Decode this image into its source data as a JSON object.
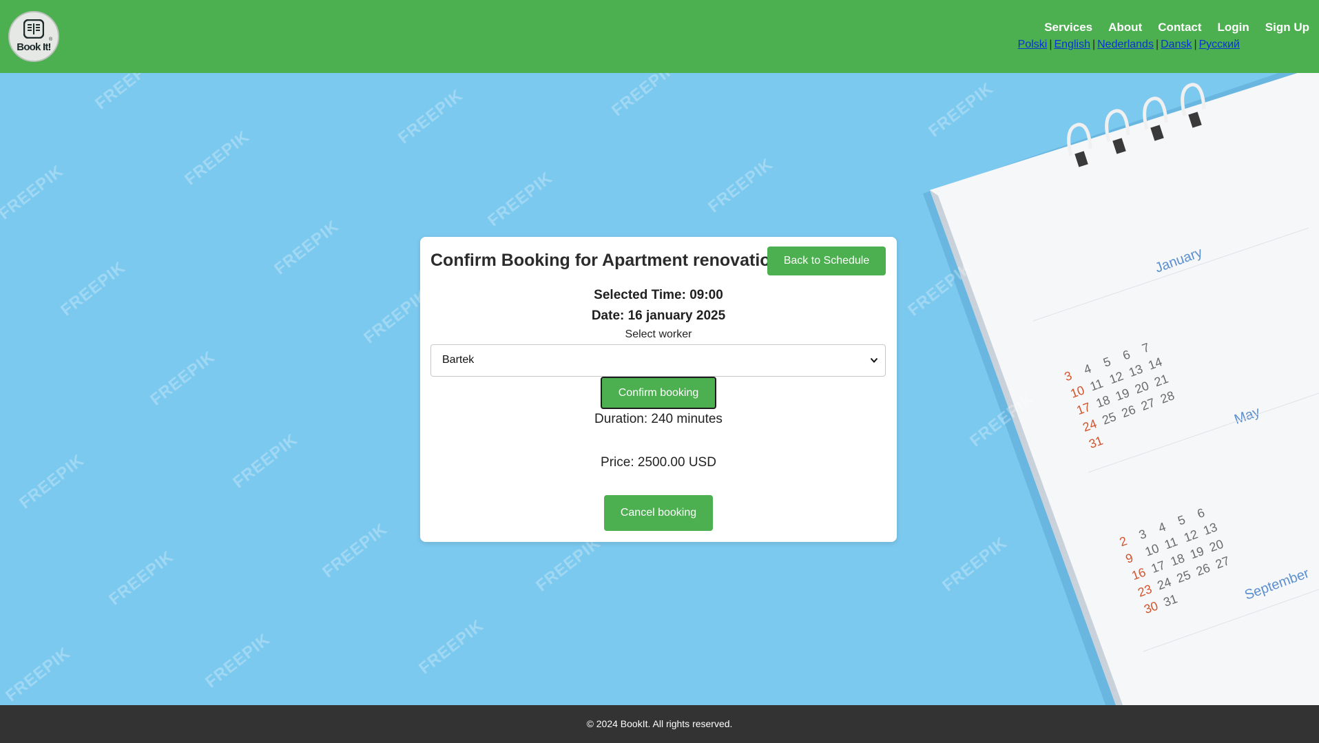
{
  "brand": {
    "logo_text": "Book It!",
    "logo_mark": "®"
  },
  "nav": {
    "items": [
      "Services",
      "About",
      "Contact",
      "Login",
      "Sign Up"
    ]
  },
  "languages": [
    "Polski",
    "English",
    "Nederlands",
    "Dansk",
    "Русский"
  ],
  "language_separator": "|",
  "background": {
    "watermark_text": "FREEPIK",
    "calendar_months": [
      "January",
      "May",
      "September"
    ]
  },
  "booking": {
    "title": "Confirm Booking for Apartment renovation",
    "back_label": "Back to Schedule",
    "selected_time": "Selected Time: 09:00",
    "date": "Date: 16 january 2025",
    "worker_label": "Select worker",
    "worker_value": "Bartek",
    "confirm_label": "Confirm booking",
    "duration": "Duration: 240 minutes",
    "price": "Price: 2500.00 USD",
    "cancel_label": "Cancel booking"
  },
  "footer": {
    "copyright": "© 2024 BookIt. All rights reserved."
  },
  "colors": {
    "header_green": "#4caf50",
    "button_green": "#4caf50",
    "link_blue": "#0a32d6",
    "footer_dark": "#333333",
    "background_blue": "#7cc9ef"
  }
}
